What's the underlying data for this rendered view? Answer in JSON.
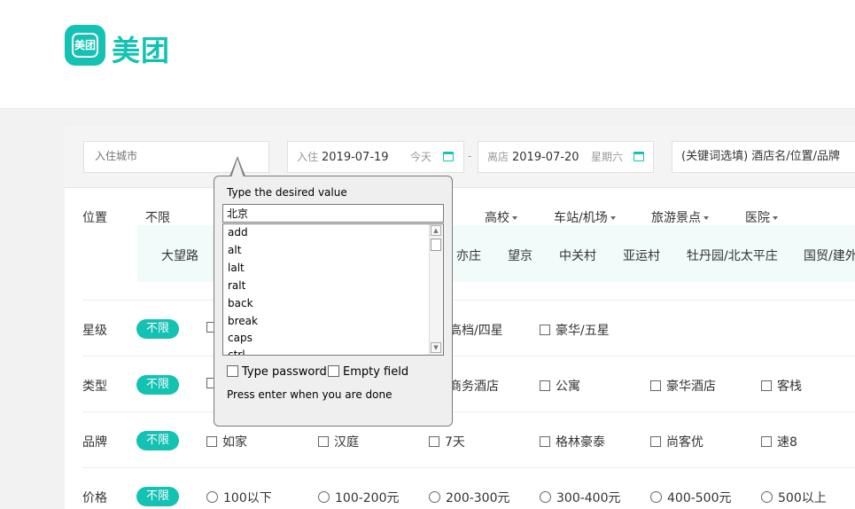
{
  "logo": {
    "badge_text": "美团",
    "text": "美团"
  },
  "search": {
    "city_placeholder": "入住城市",
    "checkin_label": "入住",
    "checkin_date": "2019-07-19",
    "checkin_day": "今天",
    "dash": "-",
    "checkout_label": "离店",
    "checkout_date": "2019-07-20",
    "checkout_day": "星期六",
    "keyword_placeholder": "(关键词选填) 酒店名/位置/品牌"
  },
  "location": {
    "label": "位置",
    "items": [
      "不限",
      "高校",
      "车站/机场",
      "旅游景点",
      "医院"
    ],
    "subitems": [
      "大望路",
      "亦庄",
      "望京",
      "中关村",
      "亚运村",
      "牡丹园/北太平庄",
      "国贸/建外"
    ]
  },
  "star": {
    "label": "星级",
    "all": "不限",
    "options": [
      "高档/四星",
      "豪华/五星"
    ]
  },
  "type": {
    "label": "类型",
    "all": "不限",
    "options": [
      "商务酒店",
      "公寓",
      "豪华酒店",
      "客栈"
    ]
  },
  "brand": {
    "label": "品牌",
    "all": "不限",
    "options": [
      "如家",
      "汉庭",
      "7天",
      "格林豪泰",
      "尚客优",
      "速8"
    ]
  },
  "price": {
    "label": "价格",
    "all": "不限",
    "options": [
      "100以下",
      "100-200元",
      "200-300元",
      "300-400元",
      "400-500元",
      "500以上"
    ]
  },
  "popup": {
    "title": "Type the desired value",
    "input_value": "北京",
    "list": [
      "add",
      "alt",
      "lalt",
      "ralt",
      "back",
      "break",
      "caps",
      "ctrl"
    ],
    "type_password": "Type password",
    "empty_field": "Empty field",
    "hint": "Press enter when you are done"
  },
  "colors": {
    "accent": "#13c2b2",
    "sublist_bg": "#f0fbfa"
  }
}
